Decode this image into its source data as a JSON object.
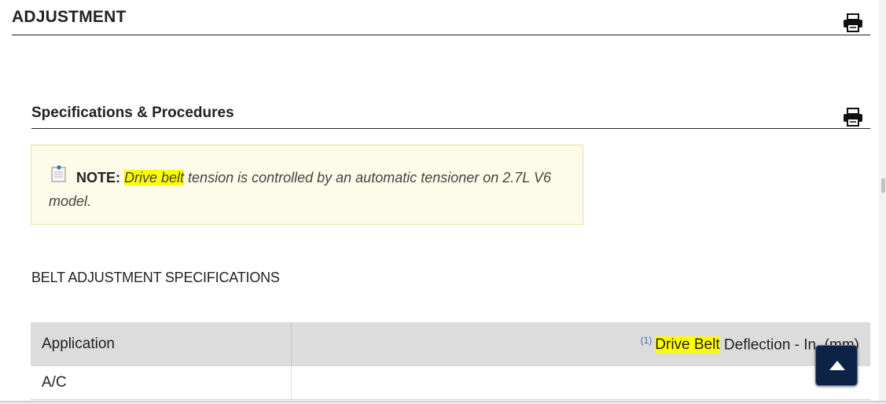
{
  "heading": "ADJUSTMENT",
  "subheading": "Specifications & Procedures",
  "note": {
    "label": "NOTE:",
    "highlight": "Drive belt",
    "text": " tension is controlled by an automatic tensioner on 2.7L V6 model."
  },
  "section_title": "BELT ADJUSTMENT SPECIFICATIONS",
  "table": {
    "col1": "Application",
    "col2_sup": "(1)",
    "col2_highlight": "Drive Belt",
    "col2_rest": " Deflection - In. (mm)",
    "rows": [
      {
        "application": "A/C",
        "value": ""
      }
    ]
  },
  "icons": {
    "print": "print-icon",
    "note": "note-icon",
    "scroll_top": "arrow-up-icon"
  },
  "colors": {
    "highlight": "#ffff00",
    "note_bg": "#fdfbe9",
    "header_bg": "#dcdcdc",
    "scroll_btn": "#0d2346"
  }
}
